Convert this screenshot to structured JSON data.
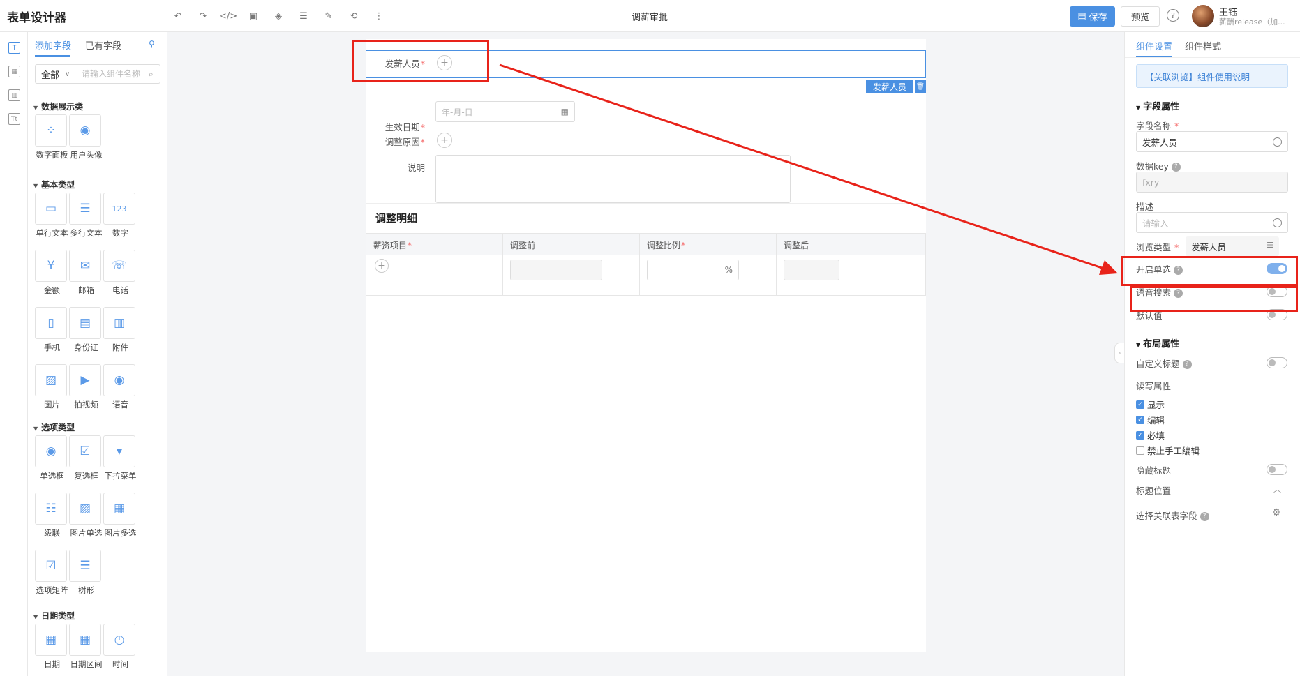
{
  "header": {
    "app_title": "表单设计器",
    "doc_title": "调薪审批",
    "save_label": "保存",
    "preview_label": "预览",
    "user_name": "王钰",
    "user_sub": "薪酬release（加..."
  },
  "toolbar_icons": [
    "undo-icon",
    "redo-icon",
    "code-icon",
    "image-icon",
    "layers-icon",
    "database-icon",
    "edit-icon",
    "history-icon",
    "more-icon"
  ],
  "component_panel": {
    "tabs": [
      "添加字段",
      "已有字段"
    ],
    "filter_value": "全部",
    "search_placeholder": "请输入组件名称",
    "categories": [
      {
        "title": "数据展示类",
        "items": [
          "数字面板",
          "用户头像"
        ]
      },
      {
        "title": "基本类型",
        "items": [
          "单行文本",
          "多行文本",
          "数字",
          "金额",
          "邮箱",
          "电话",
          "手机",
          "身份证",
          "附件",
          "图片",
          "拍视频",
          "语音"
        ]
      },
      {
        "title": "选项类型",
        "items": [
          "单选框",
          "复选框",
          "下拉菜单",
          "级联",
          "图片单选",
          "图片多选",
          "选项矩阵",
          "树形"
        ]
      },
      {
        "title": "日期类型",
        "items": [
          "日期",
          "日期区间",
          "时间"
        ]
      }
    ]
  },
  "form": {
    "fields": [
      {
        "label": "发薪人员",
        "required": "*"
      },
      {
        "label": "生效日期",
        "required": "*",
        "placeholder": "年-月-日"
      },
      {
        "label": "调整原因",
        "required": "*"
      },
      {
        "label": "说明",
        "required": ""
      }
    ],
    "selected_tag": "发薪人员",
    "subtable_title": "调整明细",
    "subtable_columns": [
      {
        "label": "薪资项目",
        "required": "*"
      },
      {
        "label": "调整前",
        "required": ""
      },
      {
        "label": "调整比例",
        "required": "*"
      },
      {
        "label": "调整后",
        "required": ""
      }
    ],
    "percent_suffix": "%"
  },
  "settings": {
    "tabs": [
      "组件设置",
      "组件样式"
    ],
    "usage_link": "【关联浏览】组件使用说明",
    "field_section": "字段属性",
    "field_name_label": "字段名称",
    "field_name_value": "发薪人员",
    "data_key_label": "数据key",
    "data_key_value": "fxry",
    "desc_label": "描述",
    "desc_placeholder": "请输入",
    "browse_type_label": "浏览类型",
    "browse_type_value": "发薪人员",
    "single_select_label": "开启单选",
    "single_select_on": true,
    "voice_search_label": "语音搜索",
    "default_value_label": "默认值",
    "layout_section": "布局属性",
    "custom_title_label": "自定义标题",
    "rw_label": "读写属性",
    "checkboxes": [
      {
        "label": "显示",
        "checked": true
      },
      {
        "label": "编辑",
        "checked": true
      },
      {
        "label": "必填",
        "checked": true
      },
      {
        "label": "禁止手工编辑",
        "checked": false
      }
    ],
    "hide_title_label": "隐藏标题",
    "title_position_label": "标题位置",
    "link_field_label": "选择关联表字段"
  },
  "colors": {
    "accent": "#4a90e2",
    "annotation_red": "#e8231a",
    "required_red": "#f56c6c"
  }
}
